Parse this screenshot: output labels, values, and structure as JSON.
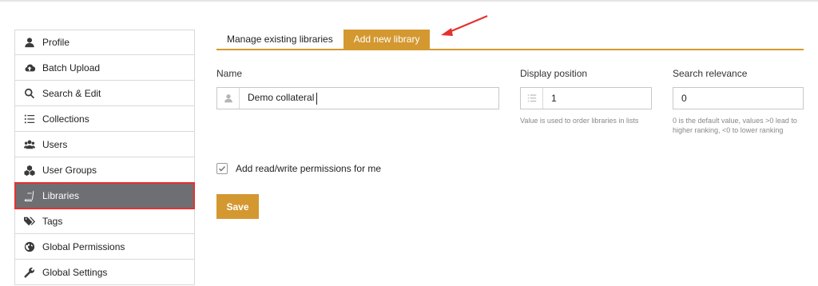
{
  "sidebar": {
    "items": [
      {
        "label": "Profile",
        "icon": "user-icon"
      },
      {
        "label": "Batch Upload",
        "icon": "cloud-upload-icon"
      },
      {
        "label": "Search & Edit",
        "icon": "search-icon"
      },
      {
        "label": "Collections",
        "icon": "list-icon"
      },
      {
        "label": "Users",
        "icon": "users-icon"
      },
      {
        "label": "User Groups",
        "icon": "cubes-icon"
      },
      {
        "label": "Libraries",
        "icon": "book-icon",
        "active": true
      },
      {
        "label": "Tags",
        "icon": "tags-icon"
      },
      {
        "label": "Global Permissions",
        "icon": "globe-icon"
      },
      {
        "label": "Global Settings",
        "icon": "wrench-icon"
      }
    ]
  },
  "tabs": [
    {
      "label": "Manage existing libraries",
      "active": false
    },
    {
      "label": "Add new library",
      "active": true
    }
  ],
  "form": {
    "name_label": "Name",
    "name_value": "Demo collateral",
    "display_position_label": "Display position",
    "display_position_value": "1",
    "display_position_help": "Value is used to order libraries in lists",
    "search_relevance_label": "Search relevance",
    "search_relevance_value": "0",
    "search_relevance_help": "0 is the default value, values >0 lead to higher ranking, <0 to lower ranking",
    "permissions_label": "Add read/write permissions for me",
    "permissions_checked": true,
    "save_label": "Save"
  },
  "colors": {
    "accent": "#d49830",
    "active_sidebar": "#6e6f73",
    "highlight": "#e3322f"
  }
}
